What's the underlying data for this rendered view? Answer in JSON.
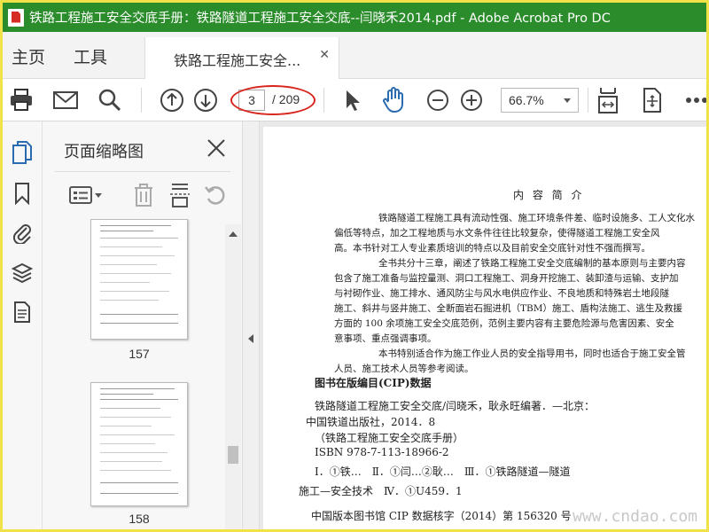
{
  "window": {
    "title": "铁路工程施工安全交底手册：铁路隧道工程施工安全交底--闫晓禾2014.pdf - Adobe Acrobat Pro DC"
  },
  "menu": {
    "home": "主页",
    "tools": "工具",
    "doc_tab": "铁路工程施工安全..."
  },
  "toolbar": {
    "page_current": "3",
    "page_total": "/ 209",
    "zoom": "66.7%"
  },
  "panel": {
    "title": "页面缩略图",
    "thumbnails": [
      {
        "label": "157"
      },
      {
        "label": "158"
      }
    ]
  },
  "document": {
    "heading": "内 容 简 介",
    "lines": [
      "铁路隧道工程施工具有流动性强、施工环境条件差、临时设施多、工人文化水",
      "偏低等特点，加之工程地质与水文条件往往比较复杂，使得隧道工程施工安全风",
      "高。本书针对工人专业素质培训的特点以及目前安全交底针对性不强而撰写。",
      "全书共分十三章，阐述了铁路工程施工安全交底编制的基本原则与主要内容",
      "包含了施工准备与监控量测、洞口工程施工、洞身开挖施工、装卸渣与运输、支护加",
      "与衬砌作业、施工排水、通风防尘与风水电供应作业、不良地质和特殊岩土地段隧",
      "施工、斜井与竖井施工、全断面岩石掘进机（TBM）施工、盾构法施工、逃生及救援",
      "方面的 100 余项施工安全交底范例，范例主要内容有主要危险源与危害因素、安全",
      "意事项、重点强调事项。",
      "本书特别适合作为施工作业人员的安全指导用书，同时也适合于施工安全管",
      "人员、施工技术人员等参考阅读。"
    ],
    "cip_title": "图书在版编目(CIP)数据",
    "cip_lines": [
      "铁路隧道工程施工安全交底/闫晓禾，耿永旺编著．—北京：",
      "中国铁道出版社，2014．8",
      "（铁路工程施工安全交底手册）",
      "ISBN 978-7-113-18966-2",
      "Ⅰ．①铁…　Ⅱ．①闫…②耿…　Ⅲ．①铁路隧道—隧道",
      "施工—安全技术　Ⅳ．①U459．1",
      "中国版本图书馆 CIP 数据核字（2014）第 156320 号"
    ],
    "watermark": "www.cndao.com"
  },
  "colors": {
    "titlebar": "#2a8c2a",
    "annotation_oval": "#d9241c",
    "icon_blue": "#2b6cb0",
    "highlight_yellow": "#f2e24a"
  }
}
